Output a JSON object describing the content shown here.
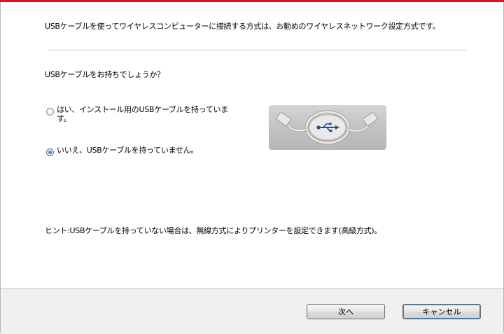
{
  "dialog": {
    "intro_text": "USBケーブルを使ってワイヤレスコンピューターに接続する方式は、お勧めのワイヤレスネットワーク設定方式です。",
    "question": "USBケーブルをお持ちでしょうか？",
    "options": [
      {
        "label": "はい、インストール用のUSBケーブルを持っています。",
        "selected": false
      },
      {
        "label": "いいえ、USBケーブルを持っていません。",
        "selected": true
      }
    ],
    "image_icon": "usb-cable-image",
    "hint": "ヒント:USBケーブルを持っていない場合は、無線方式によりプリンターを設定できます(高級方式)。"
  },
  "buttons": {
    "next": "次へ",
    "cancel": "キャンセル"
  },
  "colors": {
    "accent": "#e0101e",
    "usb_symbol": "#1f4f9c"
  }
}
